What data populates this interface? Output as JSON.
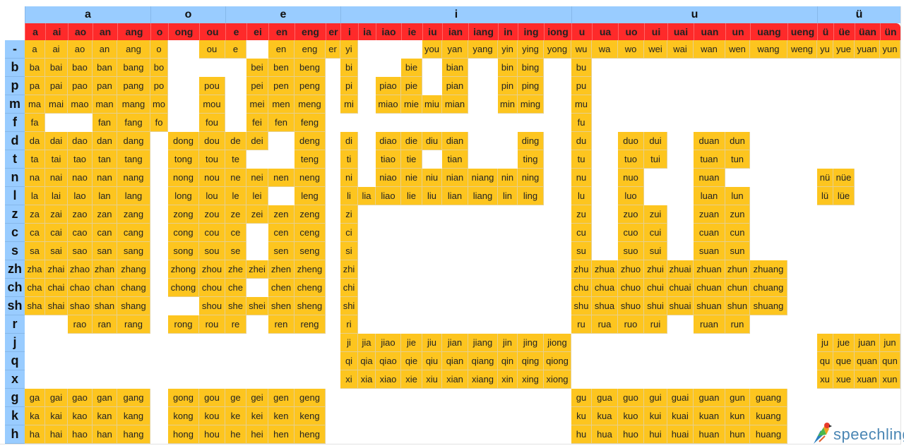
{
  "groups": [
    {
      "label": "a",
      "span": 5
    },
    {
      "label": "o",
      "span": 3
    },
    {
      "label": "e",
      "span": 5
    },
    {
      "label": "i",
      "span": 10
    },
    {
      "label": "u",
      "span": 9
    },
    {
      "label": "ü",
      "span": 4
    }
  ],
  "finals": [
    "a",
    "ai",
    "ao",
    "an",
    "ang",
    "o",
    "ong",
    "ou",
    "e",
    "ei",
    "en",
    "eng",
    "er",
    "i",
    "ia",
    "iao",
    "ie",
    "iu",
    "ian",
    "iang",
    "in",
    "ing",
    "iong",
    "u",
    "ua",
    "uo",
    "ui",
    "uai",
    "uan",
    "un",
    "uang",
    "ueng",
    "ü",
    "üe",
    "üan",
    "ün"
  ],
  "rows": [
    {
      "initial": "-",
      "cells": [
        "a",
        "ai",
        "ao",
        "an",
        "ang",
        "o",
        "",
        "ou",
        "e",
        "",
        "en",
        "eng",
        "er",
        "yi",
        "",
        "",
        "",
        "you",
        "yan",
        "yang",
        "yin",
        "ying",
        "yong",
        "wu",
        "wa",
        "wo",
        "wei",
        "wai",
        "wan",
        "wen",
        "wang",
        "weng",
        "yu",
        "yue",
        "yuan",
        "yun"
      ]
    },
    {
      "initial": "b",
      "cells": [
        "ba",
        "bai",
        "bao",
        "ban",
        "bang",
        "bo",
        "",
        "",
        "",
        "bei",
        "ben",
        "beng",
        "",
        "bi",
        "",
        "",
        "bie",
        "",
        "bian",
        "",
        "bin",
        "bing",
        "",
        "bu",
        "",
        "",
        "",
        "",
        "",
        "",
        "",
        "",
        "",
        "",
        "",
        ""
      ]
    },
    {
      "initial": "p",
      "cells": [
        "pa",
        "pai",
        "pao",
        "pan",
        "pang",
        "po",
        "",
        "pou",
        "",
        "pei",
        "pen",
        "peng",
        "",
        "pi",
        "",
        "piao",
        "pie",
        "",
        "pian",
        "",
        "pin",
        "ping",
        "",
        "pu",
        "",
        "",
        "",
        "",
        "",
        "",
        "",
        "",
        "",
        "",
        "",
        ""
      ]
    },
    {
      "initial": "m",
      "cells": [
        "ma",
        "mai",
        "mao",
        "man",
        "mang",
        "mo",
        "",
        "mou",
        "",
        "mei",
        "men",
        "meng",
        "",
        "mi",
        "",
        "miao",
        "mie",
        "miu",
        "mian",
        "",
        "min",
        "ming",
        "",
        "mu",
        "",
        "",
        "",
        "",
        "",
        "",
        "",
        "",
        "",
        "",
        "",
        ""
      ]
    },
    {
      "initial": "f",
      "cells": [
        "fa",
        "",
        "",
        "fan",
        "fang",
        "fo",
        "",
        "fou",
        "",
        "fei",
        "fen",
        "feng",
        "",
        "",
        "",
        "",
        "",
        "",
        "",
        "",
        "",
        "",
        "",
        "fu",
        "",
        "",
        "",
        "",
        "",
        "",
        "",
        "",
        "",
        "",
        "",
        ""
      ]
    },
    {
      "initial": "d",
      "cells": [
        "da",
        "dai",
        "dao",
        "dan",
        "dang",
        "",
        "dong",
        "dou",
        "de",
        "dei",
        "",
        "deng",
        "",
        "di",
        "",
        "diao",
        "die",
        "diu",
        "dian",
        "",
        "",
        "ding",
        "",
        "du",
        "",
        "duo",
        "dui",
        "",
        "duan",
        "dun",
        "",
        "",
        "",
        "",
        "",
        ""
      ]
    },
    {
      "initial": "t",
      "cells": [
        "ta",
        "tai",
        "tao",
        "tan",
        "tang",
        "",
        "tong",
        "tou",
        "te",
        "",
        "",
        "teng",
        "",
        "ti",
        "",
        "tiao",
        "tie",
        "",
        "tian",
        "",
        "",
        "ting",
        "",
        "tu",
        "",
        "tuo",
        "tui",
        "",
        "tuan",
        "tun",
        "",
        "",
        "",
        "",
        "",
        ""
      ]
    },
    {
      "initial": "n",
      "cells": [
        "na",
        "nai",
        "nao",
        "nan",
        "nang",
        "",
        "nong",
        "nou",
        "ne",
        "nei",
        "nen",
        "neng",
        "",
        "ni",
        "",
        "niao",
        "nie",
        "niu",
        "nian",
        "niang",
        "nin",
        "ning",
        "",
        "nu",
        "",
        "nuo",
        "",
        "",
        "nuan",
        "",
        "",
        "",
        "nü",
        "nüe",
        "",
        ""
      ]
    },
    {
      "initial": "l",
      "cells": [
        "la",
        "lai",
        "lao",
        "lan",
        "lang",
        "",
        "long",
        "lou",
        "le",
        "lei",
        "",
        "leng",
        "",
        "li",
        "lia",
        "liao",
        "lie",
        "liu",
        "lian",
        "liang",
        "lin",
        "ling",
        "",
        "lu",
        "",
        "luo",
        "",
        "",
        "luan",
        "lun",
        "",
        "",
        "lü",
        "lüe",
        "",
        ""
      ]
    },
    {
      "initial": "z",
      "cells": [
        "za",
        "zai",
        "zao",
        "zan",
        "zang",
        "",
        "zong",
        "zou",
        "ze",
        "zei",
        "zen",
        "zeng",
        "",
        "zi",
        "",
        "",
        "",
        "",
        "",
        "",
        "",
        "",
        "",
        "zu",
        "",
        "zuo",
        "zui",
        "",
        "zuan",
        "zun",
        "",
        "",
        "",
        "",
        "",
        ""
      ]
    },
    {
      "initial": "c",
      "cells": [
        "ca",
        "cai",
        "cao",
        "can",
        "cang",
        "",
        "cong",
        "cou",
        "ce",
        "",
        "cen",
        "ceng",
        "",
        "ci",
        "",
        "",
        "",
        "",
        "",
        "",
        "",
        "",
        "",
        "cu",
        "",
        "cuo",
        "cui",
        "",
        "cuan",
        "cun",
        "",
        "",
        "",
        "",
        "",
        ""
      ]
    },
    {
      "initial": "s",
      "cells": [
        "sa",
        "sai",
        "sao",
        "san",
        "sang",
        "",
        "song",
        "sou",
        "se",
        "",
        "sen",
        "seng",
        "",
        "si",
        "",
        "",
        "",
        "",
        "",
        "",
        "",
        "",
        "",
        "su",
        "",
        "suo",
        "sui",
        "",
        "suan",
        "sun",
        "",
        "",
        "",
        "",
        "",
        ""
      ]
    },
    {
      "initial": "zh",
      "cells": [
        "zha",
        "zhai",
        "zhao",
        "zhan",
        "zhang",
        "",
        "zhong",
        "zhou",
        "zhe",
        "zhei",
        "zhen",
        "zheng",
        "",
        "zhi",
        "",
        "",
        "",
        "",
        "",
        "",
        "",
        "",
        "",
        "zhu",
        "zhua",
        "zhuo",
        "zhui",
        "zhuai",
        "zhuan",
        "zhun",
        "zhuang",
        "",
        "",
        "",
        "",
        ""
      ]
    },
    {
      "initial": "ch",
      "cells": [
        "cha",
        "chai",
        "chao",
        "chan",
        "chang",
        "",
        "chong",
        "chou",
        "che",
        "",
        "chen",
        "cheng",
        "",
        "chi",
        "",
        "",
        "",
        "",
        "",
        "",
        "",
        "",
        "",
        "chu",
        "chua",
        "chuo",
        "chui",
        "chuai",
        "chuan",
        "chun",
        "chuang",
        "",
        "",
        "",
        "",
        ""
      ]
    },
    {
      "initial": "sh",
      "cells": [
        "sha",
        "shai",
        "shao",
        "shan",
        "shang",
        "",
        "",
        "shou",
        "she",
        "shei",
        "shen",
        "sheng",
        "",
        "shi",
        "",
        "",
        "",
        "",
        "",
        "",
        "",
        "",
        "",
        "shu",
        "shua",
        "shuo",
        "shui",
        "shuai",
        "shuan",
        "shun",
        "shuang",
        "",
        "",
        "",
        "",
        ""
      ]
    },
    {
      "initial": "r",
      "cells": [
        "",
        "",
        "rao",
        "ran",
        "rang",
        "",
        "rong",
        "rou",
        "re",
        "",
        "ren",
        "reng",
        "",
        "ri",
        "",
        "",
        "",
        "",
        "",
        "",
        "",
        "",
        "",
        "ru",
        "rua",
        "ruo",
        "rui",
        "",
        "ruan",
        "run",
        "",
        "",
        "",
        "",
        "",
        ""
      ]
    },
    {
      "initial": "j",
      "cells": [
        "",
        "",
        "",
        "",
        "",
        "",
        "",
        "",
        "",
        "",
        "",
        "",
        "",
        "ji",
        "jia",
        "jiao",
        "jie",
        "jiu",
        "jian",
        "jiang",
        "jin",
        "jing",
        "jiong",
        "",
        "",
        "",
        "",
        "",
        "",
        "",
        "",
        "",
        "ju",
        "jue",
        "juan",
        "jun"
      ]
    },
    {
      "initial": "q",
      "cells": [
        "",
        "",
        "",
        "",
        "",
        "",
        "",
        "",
        "",
        "",
        "",
        "",
        "",
        "qi",
        "qia",
        "qiao",
        "qie",
        "qiu",
        "qian",
        "qiang",
        "qin",
        "qing",
        "qiong",
        "",
        "",
        "",
        "",
        "",
        "",
        "",
        "",
        "",
        "qu",
        "que",
        "quan",
        "qun"
      ]
    },
    {
      "initial": "x",
      "cells": [
        "",
        "",
        "",
        "",
        "",
        "",
        "",
        "",
        "",
        "",
        "",
        "",
        "",
        "xi",
        "xia",
        "xiao",
        "xie",
        "xiu",
        "xian",
        "xiang",
        "xin",
        "xing",
        "xiong",
        "",
        "",
        "",
        "",
        "",
        "",
        "",
        "",
        "",
        "xu",
        "xue",
        "xuan",
        "xun"
      ]
    },
    {
      "initial": "g",
      "cells": [
        "ga",
        "gai",
        "gao",
        "gan",
        "gang",
        "",
        "gong",
        "gou",
        "ge",
        "gei",
        "gen",
        "geng",
        "",
        "",
        "",
        "",
        "",
        "",
        "",
        "",
        "",
        "",
        "",
        "gu",
        "gua",
        "guo",
        "gui",
        "guai",
        "guan",
        "gun",
        "guang",
        "",
        "",
        "",
        "",
        ""
      ]
    },
    {
      "initial": "k",
      "cells": [
        "ka",
        "kai",
        "kao",
        "kan",
        "kang",
        "",
        "kong",
        "kou",
        "ke",
        "kei",
        "ken",
        "keng",
        "",
        "",
        "",
        "",
        "",
        "",
        "",
        "",
        "",
        "",
        "",
        "ku",
        "kua",
        "kuo",
        "kui",
        "kuai",
        "kuan",
        "kun",
        "kuang",
        "",
        "",
        "",
        "",
        ""
      ]
    },
    {
      "initial": "h",
      "cells": [
        "ha",
        "hai",
        "hao",
        "han",
        "hang",
        "",
        "hong",
        "hou",
        "he",
        "hei",
        "hen",
        "heng",
        "",
        "",
        "",
        "",
        "",
        "",
        "",
        "",
        "",
        "",
        "",
        "hu",
        "hua",
        "huo",
        "hui",
        "huai",
        "huan",
        "hun",
        "huang",
        "",
        "",
        "",
        "",
        ""
      ]
    }
  ],
  "logo": {
    "text": "speechling",
    "icon": "parrot-icon"
  },
  "colors": {
    "group_header": "#99ccff",
    "final_header": "#fe2a2a",
    "syllable": "#fdc51f",
    "initial": "#99ccff",
    "logo": "#4a86b4"
  }
}
